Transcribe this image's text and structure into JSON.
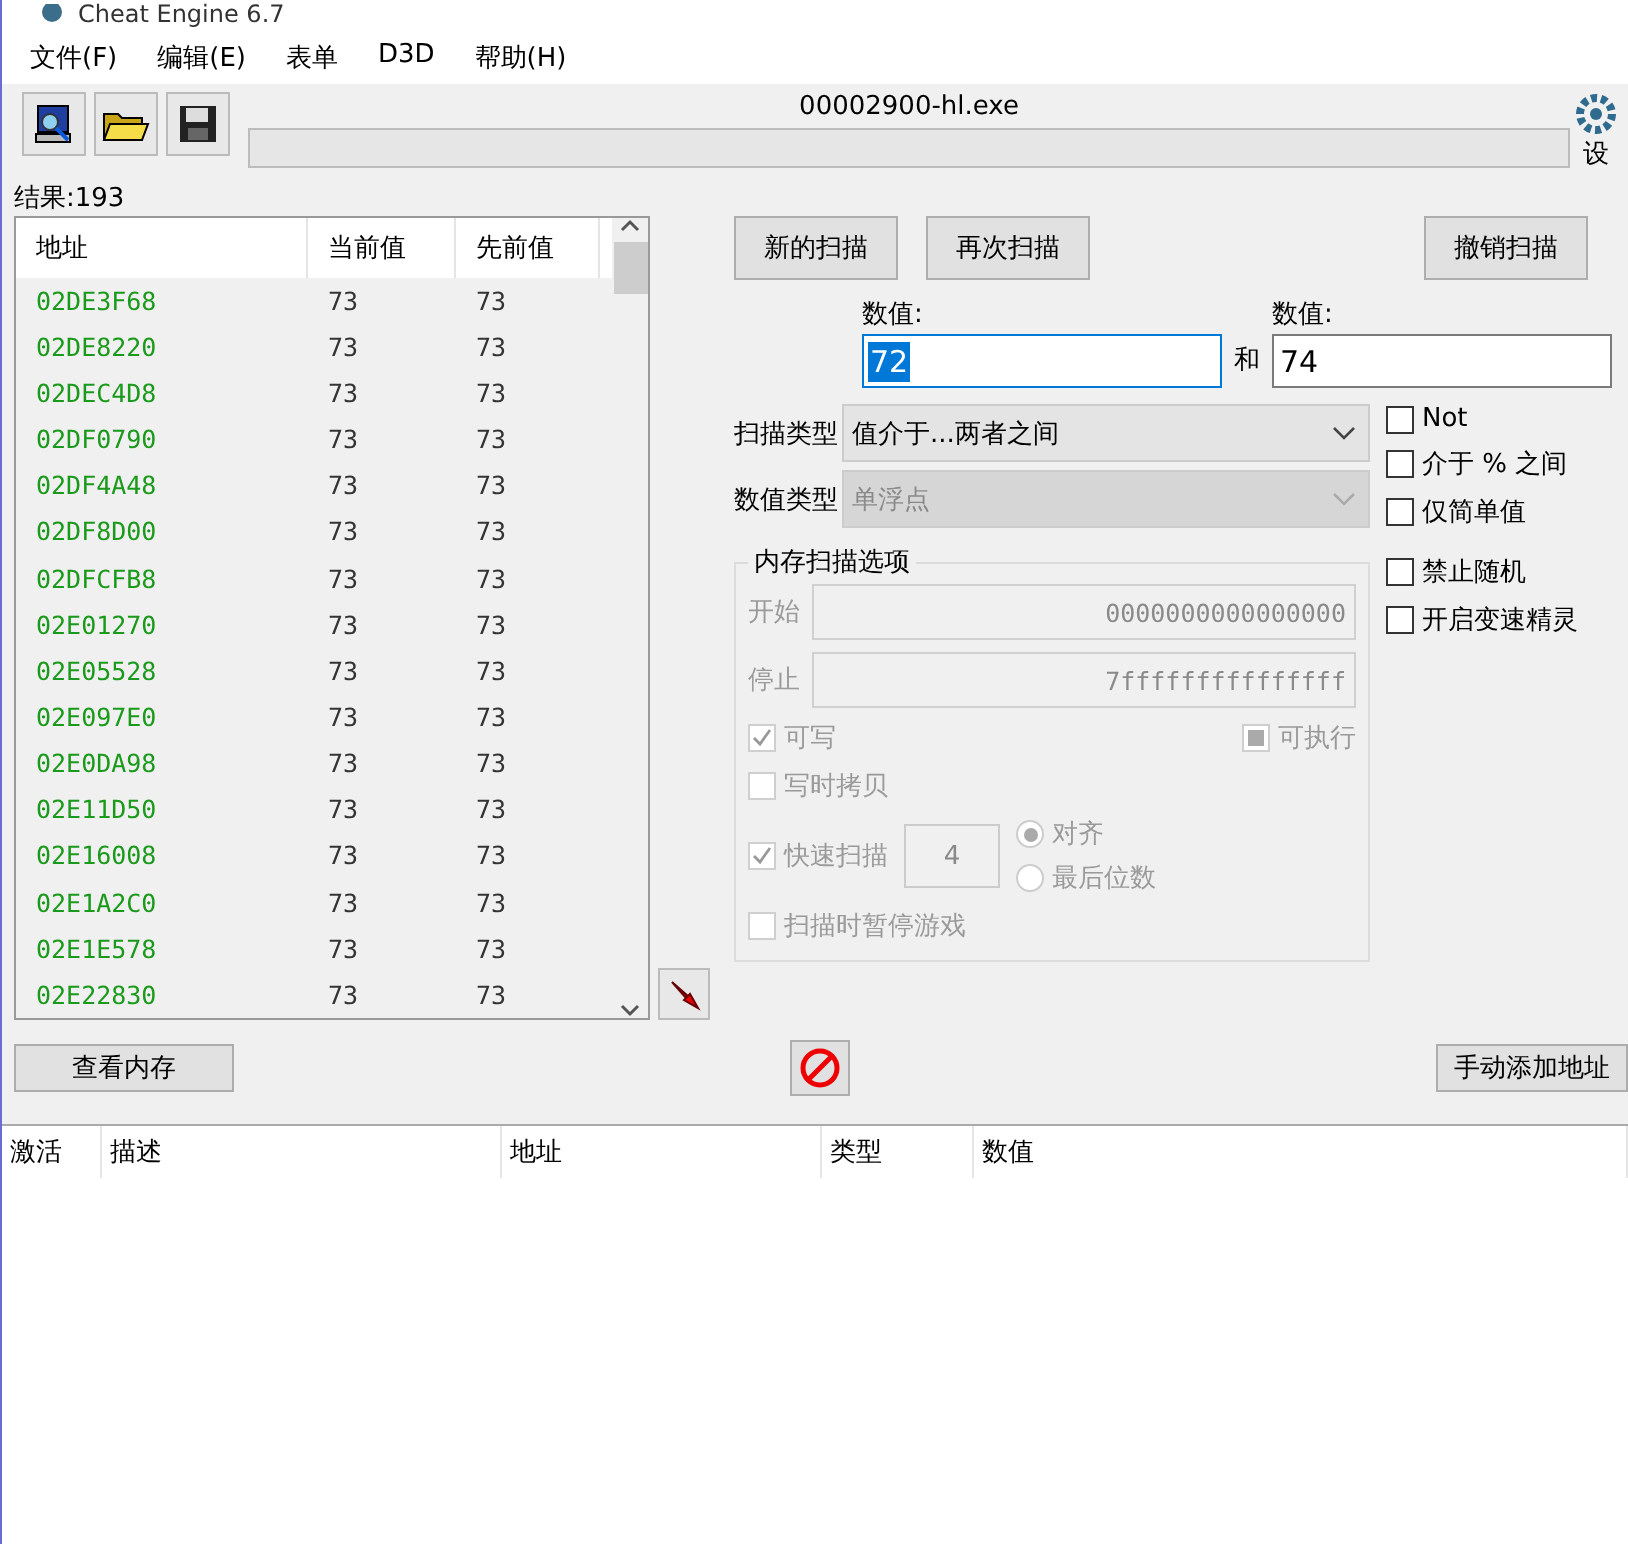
{
  "window": {
    "title": "Cheat Engine 6.7"
  },
  "menu": [
    "文件(F)",
    "编辑(E)",
    "表单",
    "D3D",
    "帮助(H)"
  ],
  "process": "00002900-hl.exe",
  "settings_label": "设",
  "results": "结果:193",
  "result_table": {
    "columns": [
      "地址",
      "当前值",
      "先前值"
    ],
    "rows": [
      {
        "address": "02DE3F68",
        "value": "73",
        "previous": "73"
      },
      {
        "address": "02DE8220",
        "value": "73",
        "previous": "73"
      },
      {
        "address": "02DEC4D8",
        "value": "73",
        "previous": "73"
      },
      {
        "address": "02DF0790",
        "value": "73",
        "previous": "73"
      },
      {
        "address": "02DF4A48",
        "value": "73",
        "previous": "73"
      },
      {
        "address": "02DF8D00",
        "value": "73",
        "previous": "73"
      },
      {
        "address": "02DFCFB8",
        "value": "73",
        "previous": "73"
      },
      {
        "address": "02E01270",
        "value": "73",
        "previous": "73"
      },
      {
        "address": "02E05528",
        "value": "73",
        "previous": "73"
      },
      {
        "address": "02E097E0",
        "value": "73",
        "previous": "73"
      },
      {
        "address": "02E0DA98",
        "value": "73",
        "previous": "73"
      },
      {
        "address": "02E11D50",
        "value": "73",
        "previous": "73"
      },
      {
        "address": "02E16008",
        "value": "73",
        "previous": "73"
      },
      {
        "address": "02E1A2C0",
        "value": "73",
        "previous": "73"
      },
      {
        "address": "02E1E578",
        "value": "73",
        "previous": "73"
      },
      {
        "address": "02E22830",
        "value": "73",
        "previous": "73"
      }
    ]
  },
  "scan_buttons": [
    "新的扫描",
    "再次扫描"
  ],
  "undo_button": "撤销扫描",
  "value1": {
    "label": "数值:",
    "value": "72",
    "selected": true
  },
  "and_label": "和",
  "value2": {
    "label": "数值:",
    "value": "74",
    "selected": false
  },
  "scan_type": {
    "label": "扫描类型",
    "value": "值介于...两者之间",
    "disabled": false
  },
  "value_type": {
    "label": "数值类型",
    "value": "单浮点",
    "disabled": true
  },
  "options": [
    {
      "label": "Not",
      "checked": false
    },
    {
      "label": "介于 % 之间",
      "checked": false
    },
    {
      "label": "仅简单值",
      "checked": false
    },
    {
      "label": "禁止随机",
      "checked": false
    },
    {
      "label": "开启变速精灵",
      "checked": false
    }
  ],
  "memory_options": {
    "title": "内存扫描选项",
    "disabled": true,
    "start": {
      "label": "开始",
      "value": "0000000000000000"
    },
    "stop": {
      "label": "停止",
      "value": "7fffffffffffffff"
    },
    "writable": {
      "label": "可写",
      "checked": true
    },
    "executable": {
      "label": "可执行",
      "checked": false,
      "indeterminate": true
    },
    "copy_on_write": {
      "label": "写时拷贝",
      "checked": false
    },
    "fast_scan": {
      "label": "快速扫描",
      "checked": true,
      "value": "4"
    },
    "alignment": [
      {
        "label": "对齐",
        "selected": true
      },
      {
        "label": "最后位数",
        "selected": false
      }
    ],
    "pause": {
      "label": "扫描时暂停游戏",
      "checked": false
    }
  },
  "view_memory": "查看内存",
  "add_address": "手动添加地址",
  "address_list": {
    "columns": [
      "激活",
      "描述",
      "地址",
      "类型",
      "数值"
    ]
  },
  "scan_progress": {
    "level": 0
  }
}
